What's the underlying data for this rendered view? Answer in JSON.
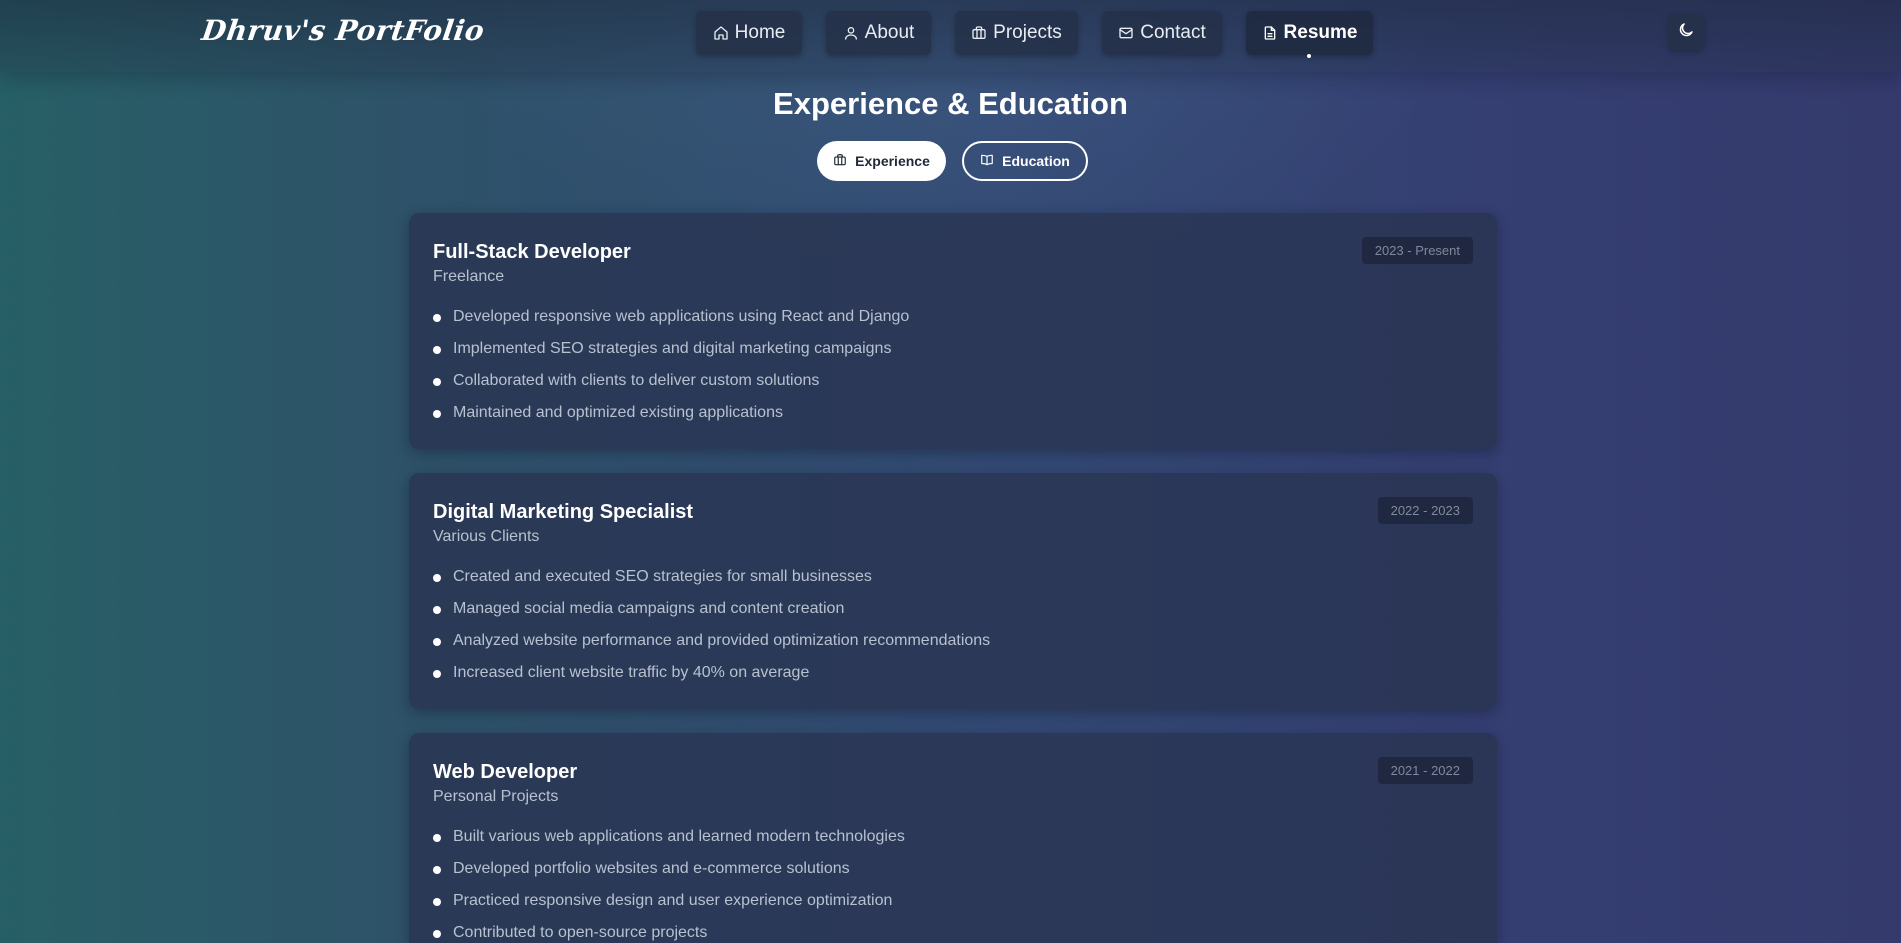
{
  "navbar": {
    "logo": "Dhruv's PortFolio",
    "items": [
      {
        "label": "Home",
        "icon": "home-icon"
      },
      {
        "label": "About",
        "icon": "user-icon"
      },
      {
        "label": "Projects",
        "icon": "briefcase-icon"
      },
      {
        "label": "Contact",
        "icon": "mail-icon"
      },
      {
        "label": "Resume",
        "icon": "document-icon",
        "active": true
      }
    ],
    "theme_toggle_icon": "moon-icon"
  },
  "header": {
    "title": "Experience & Education",
    "tabs": [
      {
        "label": "Experience",
        "icon": "briefcase-icon",
        "selected": true
      },
      {
        "label": "Education",
        "icon": "book-icon",
        "selected": false
      }
    ]
  },
  "experience": [
    {
      "title": "Full-Stack Developer",
      "org": "Freelance",
      "date": "2023 - Present",
      "bullets": [
        "Developed responsive web applications using React and Django",
        "Implemented SEO strategies and digital marketing campaigns",
        "Collaborated with clients to deliver custom solutions",
        "Maintained and optimized existing applications"
      ]
    },
    {
      "title": "Digital Marketing Specialist",
      "org": "Various Clients",
      "date": "2022 - 2023",
      "bullets": [
        "Created and executed SEO strategies for small businesses",
        "Managed social media campaigns and content creation",
        "Analyzed website performance and provided optimization recommendations",
        "Increased client website traffic by 40% on average"
      ]
    },
    {
      "title": "Web Developer",
      "org": "Personal Projects",
      "date": "2021 - 2022",
      "bullets": [
        "Built various web applications and learned modern technologies",
        "Developed portfolio websites and e-commerce solutions",
        "Practiced responsive design and user experience optimization",
        "Contributed to open-source projects"
      ]
    }
  ],
  "colors": {
    "background_left": "#275f66",
    "background_right": "#343a6c",
    "card": "#293452",
    "text_muted": "#b7c1cf"
  }
}
